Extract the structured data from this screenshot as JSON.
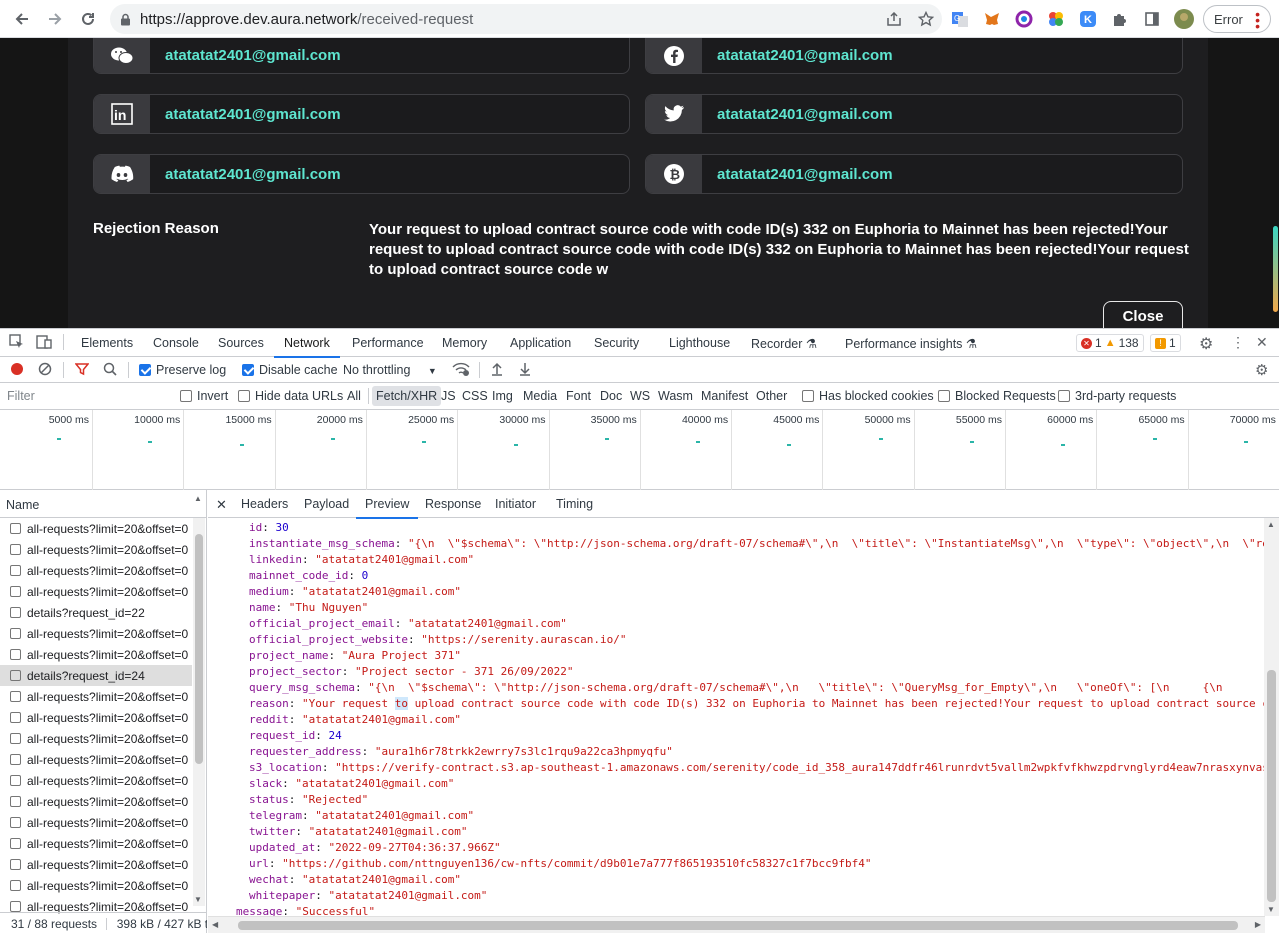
{
  "browser": {
    "url_host": "https://approve.dev.aura.network",
    "url_path": "/received-request",
    "error_label": "Error"
  },
  "page": {
    "socials": [
      {
        "icon": "wechat-icon",
        "value": "atatatat2401@gmail.com"
      },
      {
        "icon": "facebook-icon",
        "value": "atatatat2401@gmail.com"
      },
      {
        "icon": "linkedin-icon",
        "value": "atatatat2401@gmail.com"
      },
      {
        "icon": "twitter-icon",
        "value": "atatatat2401@gmail.com"
      },
      {
        "icon": "discord-icon",
        "value": "atatatat2401@gmail.com"
      },
      {
        "icon": "bitcoin-icon",
        "value": "atatatat2401@gmail.com"
      }
    ],
    "rejection_label": "Rejection Reason",
    "rejection_text": "Your request to upload contract source code with code ID(s) 332 on Euphoria to Mainnet has been rejected!Your request to upload contract source code with code ID(s) 332 on Euphoria to Mainnet has been rejected!Your request to upload contract source code w",
    "close_label": "Close",
    "accent_color": "#5ee6d0"
  },
  "devtools": {
    "tabs": [
      "Elements",
      "Console",
      "Sources",
      "Network",
      "Performance",
      "Memory",
      "Application",
      "Security",
      "Lighthouse",
      "Recorder",
      "Performance insights"
    ],
    "active_tab": "Network",
    "errors": "1",
    "warnings": "138",
    "issues": "1",
    "toolbar": {
      "preserve_log": "Preserve log",
      "disable_cache": "Disable cache",
      "throttling": "No throttling"
    },
    "filter": {
      "placeholder": "Filter",
      "invert": "Invert",
      "hide_data_urls": "Hide data URLs",
      "types": [
        "All",
        "Fetch/XHR",
        "JS",
        "CSS",
        "Img",
        "Media",
        "Font",
        "Doc",
        "WS",
        "Wasm",
        "Manifest",
        "Other"
      ],
      "has_blocked_cookies": "Has blocked cookies",
      "blocked_requests": "Blocked Requests",
      "third_party": "3rd-party requests"
    },
    "overview_ticks": [
      "5000 ms",
      "10000 ms",
      "15000 ms",
      "20000 ms",
      "25000 ms",
      "30000 ms",
      "35000 ms",
      "40000 ms",
      "45000 ms",
      "50000 ms",
      "55000 ms",
      "60000 ms",
      "65000 ms",
      "70000 ms"
    ],
    "requests_header": "Name",
    "requests": [
      "all-requests?limit=20&offset=0",
      "all-requests?limit=20&offset=0",
      "all-requests?limit=20&offset=0",
      "all-requests?limit=20&offset=0",
      "details?request_id=22",
      "all-requests?limit=20&offset=0",
      "all-requests?limit=20&offset=0",
      "details?request_id=24",
      "all-requests?limit=20&offset=0",
      "all-requests?limit=20&offset=0",
      "all-requests?limit=20&offset=0",
      "all-requests?limit=20&offset=0",
      "all-requests?limit=20&offset=0",
      "all-requests?limit=20&offset=0",
      "all-requests?limit=20&offset=0",
      "all-requests?limit=20&offset=0",
      "all-requests?limit=20&offset=0",
      "all-requests?limit=20&offset=0",
      "all-requests?limit=20&offset=0"
    ],
    "selected_request": 7,
    "status_requests": "31 / 88 requests",
    "status_size": "398 kB / 427 kB t",
    "preview_tabs": [
      "Headers",
      "Payload",
      "Preview",
      "Response",
      "Initiator",
      "Timing"
    ],
    "active_preview_tab": "Preview",
    "preview_lines": [
      {
        "key": "id",
        "value": "30",
        "kind": "n"
      },
      {
        "key": "instantiate_msg_schema",
        "value": "\"{\\n  \\\"$schema\\\": \\\"http://json-schema.org/draft-07/schema#\\\",\\n  \\\"title\\\": \\\"InstantiateMsg\\\",\\n  \\\"type\\\": \\\"object\\\",\\n  \\\"re",
        "kind": "s"
      },
      {
        "key": "linkedin",
        "value": "\"atatatat2401@gmail.com\"",
        "kind": "s"
      },
      {
        "key": "mainnet_code_id",
        "value": "0",
        "kind": "n"
      },
      {
        "key": "medium",
        "value": "\"atatatat2401@gmail.com\"",
        "kind": "s"
      },
      {
        "key": "name",
        "value": "\"Thu Nguyen\"",
        "kind": "s"
      },
      {
        "key": "official_project_email",
        "value": "\"atatatat2401@gmail.com\"",
        "kind": "s"
      },
      {
        "key": "official_project_website",
        "value": "\"https://serenity.aurascan.io/\"",
        "kind": "s"
      },
      {
        "key": "project_name",
        "value": "\"Aura Project 371\"",
        "kind": "s"
      },
      {
        "key": "project_sector",
        "value": "\"Project sector - 371 26/09/2022\"",
        "kind": "s"
      },
      {
        "key": "query_msg_schema",
        "value": "\"{\\n  \\\"$schema\\\": \\\"http://json-schema.org/draft-07/schema#\\\",\\n   \\\"title\\\": \\\"QueryMsg_for_Empty\\\",\\n   \\\"oneOf\\\": [\\n     {\\n",
        "kind": "s"
      },
      {
        "key": "reason",
        "value": "\"Your request to upload contract source code with code ID(s) 332 on Euphoria to Mainnet has been rejected!Your request to upload contract source c",
        "kind": "s",
        "highlight": "to"
      },
      {
        "key": "reddit",
        "value": "\"atatatat2401@gmail.com\"",
        "kind": "s"
      },
      {
        "key": "request_id",
        "value": "24",
        "kind": "n"
      },
      {
        "key": "requester_address",
        "value": "\"aura1h6r78trkk2ewrry7s3lc1rqu9a22ca3hpmyqfu\"",
        "kind": "s"
      },
      {
        "key": "s3_location",
        "value": "\"https://verify-contract.s3.ap-southeast-1.amazonaws.com/serenity/code_id_358_aura147ddfr46lrunrdvt5vallm2wpkfvfkhwzpdrvnglyrd4eaw7nrasxynvas",
        "kind": "s"
      },
      {
        "key": "slack",
        "value": "\"atatatat2401@gmail.com\"",
        "kind": "s"
      },
      {
        "key": "status",
        "value": "\"Rejected\"",
        "kind": "s"
      },
      {
        "key": "telegram",
        "value": "\"atatatat2401@gmail.com\"",
        "kind": "s"
      },
      {
        "key": "twitter",
        "value": "\"atatatat2401@gmail.com\"",
        "kind": "s"
      },
      {
        "key": "updated_at",
        "value": "\"2022-09-27T04:36:37.966Z\"",
        "kind": "s"
      },
      {
        "key": "url",
        "value": "\"https://github.com/nttnguyen136/cw-nfts/commit/d9b01e7a777f865193510fc58327c1f7bcc9fbf4\"",
        "kind": "s"
      },
      {
        "key": "wechat",
        "value": "\"atatatat2401@gmail.com\"",
        "kind": "s"
      },
      {
        "key": "whitepaper",
        "value": "\"atatatat2401@gmail.com\"",
        "kind": "s"
      }
    ],
    "message_key": "message",
    "message_value": "\"Successful\""
  }
}
